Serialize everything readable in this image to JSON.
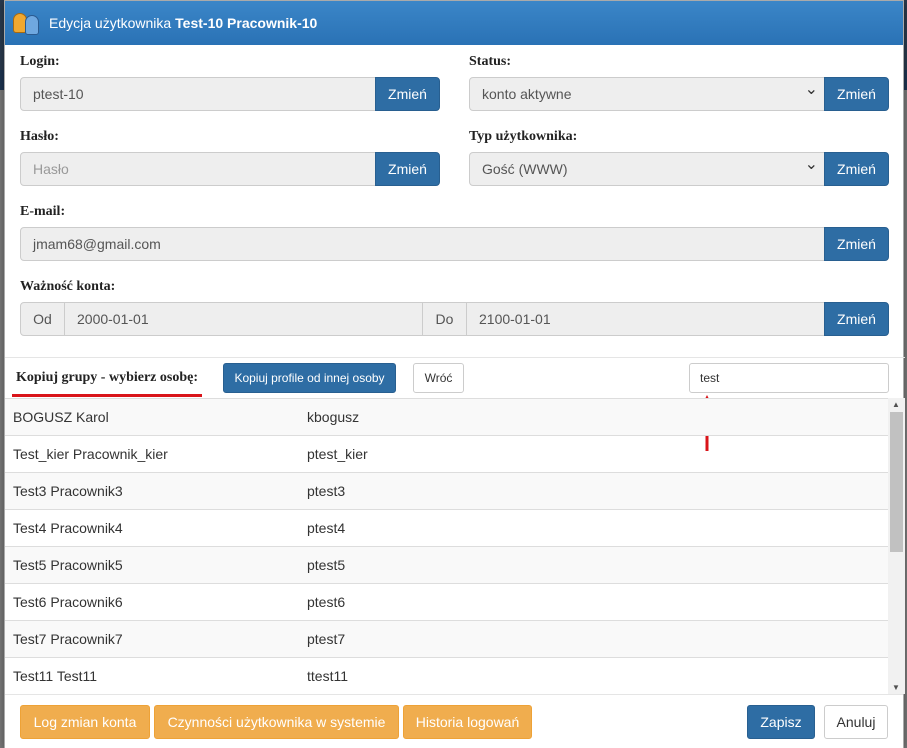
{
  "dialog": {
    "title_prefix": "Edycja użytkownika",
    "title_user": "Test-10 Pracownik-10"
  },
  "form": {
    "login": {
      "label": "Login:",
      "value": "ptest-10",
      "button": "Zmień"
    },
    "status": {
      "label": "Status:",
      "value": "konto aktywne",
      "button": "Zmień"
    },
    "password": {
      "label": "Hasło:",
      "placeholder": "Hasło",
      "button": "Zmień"
    },
    "user_type": {
      "label": "Typ użytkownika:",
      "value": "Gość (WWW)",
      "button": "Zmień"
    },
    "email": {
      "label": "E-mail:",
      "value": "jmam68@gmail.com",
      "button": "Zmień"
    },
    "validity": {
      "label": "Ważność konta:",
      "from_label": "Od",
      "from_value": "2000-01-01",
      "to_label": "Do",
      "to_value": "2100-01-01",
      "button": "Zmień"
    }
  },
  "copy_groups": {
    "label": "Kopiuj grupy - wybierz osobę:",
    "copy_button": "Kopiuj profile od innej osoby",
    "back_button": "Wróć",
    "search_value": "test"
  },
  "people": [
    {
      "name": "BOGUSZ Karol",
      "login": "kbogusz"
    },
    {
      "name": "Test_kier Pracownik_kier",
      "login": "ptest_kier"
    },
    {
      "name": "Test3 Pracownik3",
      "login": "ptest3"
    },
    {
      "name": "Test4 Pracownik4",
      "login": "ptest4"
    },
    {
      "name": "Test5 Pracownik5",
      "login": "ptest5"
    },
    {
      "name": "Test6 Pracownik6",
      "login": "ptest6"
    },
    {
      "name": "Test7 Pracownik7",
      "login": "ptest7"
    },
    {
      "name": "Test11 Test11",
      "login": "ttest11"
    }
  ],
  "footer": {
    "log_changes": "Log zmian konta",
    "user_activities": "Czynności użytkownika w systemie",
    "login_history": "Historia logowań",
    "save": "Zapisz",
    "cancel": "Anuluj"
  },
  "colors": {
    "primary": "#2e6da4",
    "warning": "#f0ad4e",
    "header": "#2a72b5",
    "annotation_red": "#d9141a"
  }
}
